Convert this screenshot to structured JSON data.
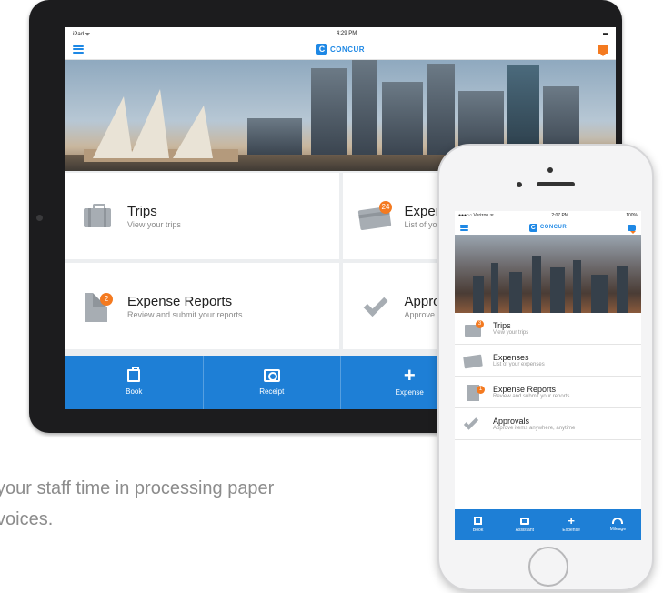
{
  "ipad": {
    "status": {
      "left": "iPad ᯤ",
      "time": "4:29 PM",
      "battery": "▬"
    },
    "brand": {
      "mark": "C",
      "name": "CONCUR"
    },
    "tiles": [
      {
        "title": "Trips",
        "subtitle": "View your trips",
        "icon": "suitcase-icon",
        "badge": ""
      },
      {
        "title": "Expenses",
        "subtitle": "List of your expe",
        "icon": "card-icon",
        "badge": "24"
      },
      {
        "title": "Expense Reports",
        "subtitle": "Review and submit your reports",
        "icon": "report-icon",
        "badge": "2"
      },
      {
        "title": "Approvals",
        "subtitle": "Approve items an",
        "icon": "check-icon",
        "badge": ""
      }
    ],
    "tabs": [
      {
        "label": "Book",
        "icon": "suitcase-icon"
      },
      {
        "label": "Receipt",
        "icon": "camera-icon"
      },
      {
        "label": "Expense",
        "icon": "plus-icon"
      }
    ]
  },
  "caption": {
    "line1": "your staff time in processing paper",
    "line2": "voices."
  },
  "iphone": {
    "status": {
      "left": "●●●○○ Verizon ᯤ",
      "time": "2:07 PM",
      "right": "100%"
    },
    "brand": {
      "mark": "C",
      "name": "CONCUR"
    },
    "items": [
      {
        "title": "Trips",
        "subtitle": "View your trips",
        "icon": "suitcase-icon",
        "badge": "3"
      },
      {
        "title": "Expenses",
        "subtitle": "List of your expenses",
        "icon": "card-icon",
        "badge": ""
      },
      {
        "title": "Expense Reports",
        "subtitle": "Review and submit your reports",
        "icon": "report-icon",
        "badge": "1"
      },
      {
        "title": "Approvals",
        "subtitle": "Approve items anywhere, anytime",
        "icon": "check-icon",
        "badge": ""
      }
    ],
    "tabs": [
      {
        "label": "Book",
        "icon": "suitcase-icon"
      },
      {
        "label": "Assistant",
        "icon": "camera-icon"
      },
      {
        "label": "Expense",
        "icon": "plus-icon"
      },
      {
        "label": "Mileage",
        "icon": "gauge-icon"
      }
    ]
  },
  "colors": {
    "accent": "#1e7fd6",
    "badge": "#f47a20",
    "icon": "#a7adb3"
  }
}
